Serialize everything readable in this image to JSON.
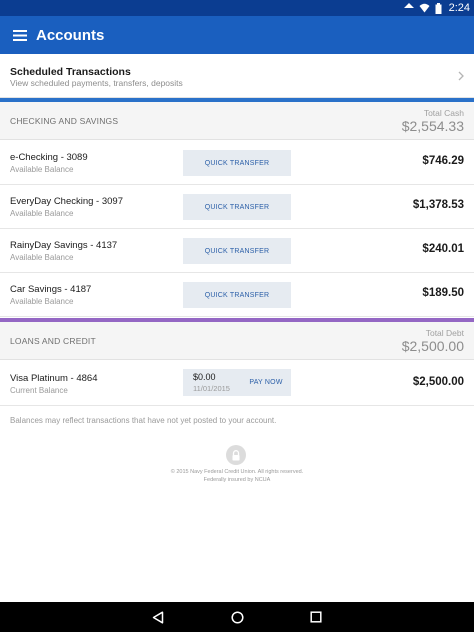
{
  "status_bar": {
    "time": "2:24"
  },
  "app_bar": {
    "title": "Accounts"
  },
  "scheduled": {
    "title": "Scheduled Transactions",
    "subtitle": "View scheduled payments, transfers, deposits"
  },
  "checking": {
    "label": "CHECKING AND SAVINGS",
    "total_label": "Total Cash",
    "total": "$2,554.33",
    "accounts": [
      {
        "name": "e-Checking - 3089",
        "sub": "Available Balance",
        "button": "QUICK TRANSFER",
        "amount": "$746.29"
      },
      {
        "name": "EveryDay Checking - 3097",
        "sub": "Available Balance",
        "button": "QUICK TRANSFER",
        "amount": "$1,378.53"
      },
      {
        "name": "RainyDay Savings - 4137",
        "sub": "Available Balance",
        "button": "QUICK TRANSFER",
        "amount": "$240.01"
      },
      {
        "name": "Car Savings - 4187",
        "sub": "Available Balance",
        "button": "QUICK TRANSFER",
        "amount": "$189.50"
      }
    ]
  },
  "loans": {
    "label": "LOANS AND CREDIT",
    "total_label": "Total Debt",
    "total": "$2,500.00",
    "accounts": [
      {
        "name": "Visa Platinum - 4864",
        "sub": "Current Balance",
        "due_amount": "$0.00",
        "due_date": "11/01/2015",
        "button": "PAY NOW",
        "amount": "$2,500.00"
      }
    ]
  },
  "footer": {
    "disclaimer": "Balances may reflect transactions that have not yet posted to your account.",
    "copyright": "© 2015 Navy Federal Credit Union. All rights reserved.",
    "insured": "Federally insured by NCUA"
  },
  "colors": {
    "status_bar": "#0b3d91",
    "app_bar": "#1a5fbf",
    "checking_accent": "#2a71c9",
    "loans_accent": "#9467c4"
  },
  "icons": [
    "wifi-icon",
    "signal-icon",
    "battery-icon",
    "menu-icon",
    "chevron-right-icon",
    "lock-icon",
    "back-icon",
    "home-icon",
    "recents-icon"
  ]
}
